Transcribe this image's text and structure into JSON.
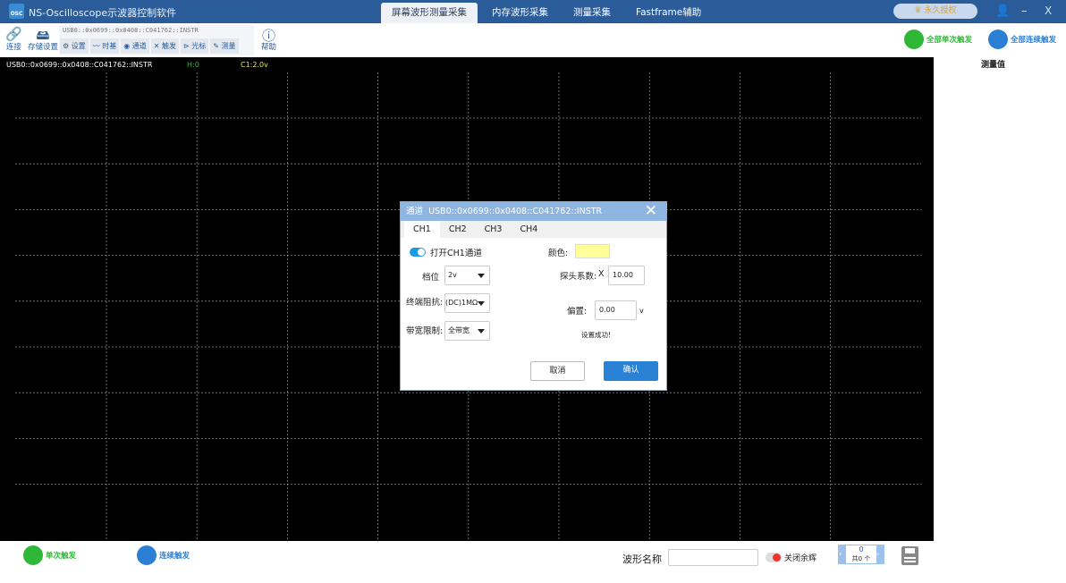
{
  "app": {
    "title": "NS-Oscilloscope示波器控制软件",
    "logo": "OSC"
  },
  "tabs": [
    {
      "label": "屏幕波形测量采集",
      "active": true
    },
    {
      "label": "内存波形采集"
    },
    {
      "label": "测量采集"
    },
    {
      "label": "Fastframe辅助"
    }
  ],
  "auth": {
    "label": "永久授权",
    "icon": "crown-icon"
  },
  "window": {
    "minimize": "–",
    "close": "X"
  },
  "toolbar": {
    "connect": "连接",
    "storage": "存储设置",
    "device": "USB0::0x0699::0x0408::C041762::INSTR",
    "sub": [
      {
        "label": "设置",
        "icon": "gear-icon"
      },
      {
        "label": "时基",
        "icon": "timebase-icon"
      },
      {
        "label": "通道",
        "icon": "channel-icon"
      },
      {
        "label": "触发",
        "icon": "trigger-icon"
      },
      {
        "label": "光标",
        "icon": "cursor-icon"
      },
      {
        "label": "测量",
        "icon": "measure-icon"
      }
    ],
    "help": "帮助",
    "all_single": "全部单次触发",
    "all_continuous": "全部连续触发"
  },
  "scope": {
    "device": "USB0::0x0699::0x0408::C041762::INSTR",
    "hd": "H:0",
    "c1": "C1:2.0v",
    "colors": {
      "hd": "#2fbf3a",
      "c1": "#e8e84a"
    }
  },
  "measure": {
    "title": "测量值"
  },
  "bottom": {
    "single": "单次触发",
    "continuous": "连续触发",
    "wave_name_label": "波形名称",
    "wave_name_value": "",
    "afterglow": "关闭余辉",
    "counter": "0",
    "counter_total": "共0 个"
  },
  "dialog": {
    "title": "通道",
    "device": "USB0::0x0699::0x0408::C041762::INSTR",
    "tabs": [
      "CH1",
      "CH2",
      "CH3",
      "CH4"
    ],
    "enable": "打开CH1通道",
    "enabled": true,
    "scale_label": "档位",
    "scale": "2v",
    "term_label": "终端阻抗:",
    "term": "(DC)1MΩ",
    "bw_label": "带宽限制:",
    "bw": "全带宽",
    "color_label": "颜色:",
    "color": "#ffff99",
    "probe_label": "探头系数:",
    "probe_x": "X",
    "probe": "10.00",
    "offset_label": "偏置:",
    "offset": "0.00",
    "offset_unit": "v",
    "status": "设置成功!",
    "cancel": "取消",
    "ok": "确认"
  }
}
